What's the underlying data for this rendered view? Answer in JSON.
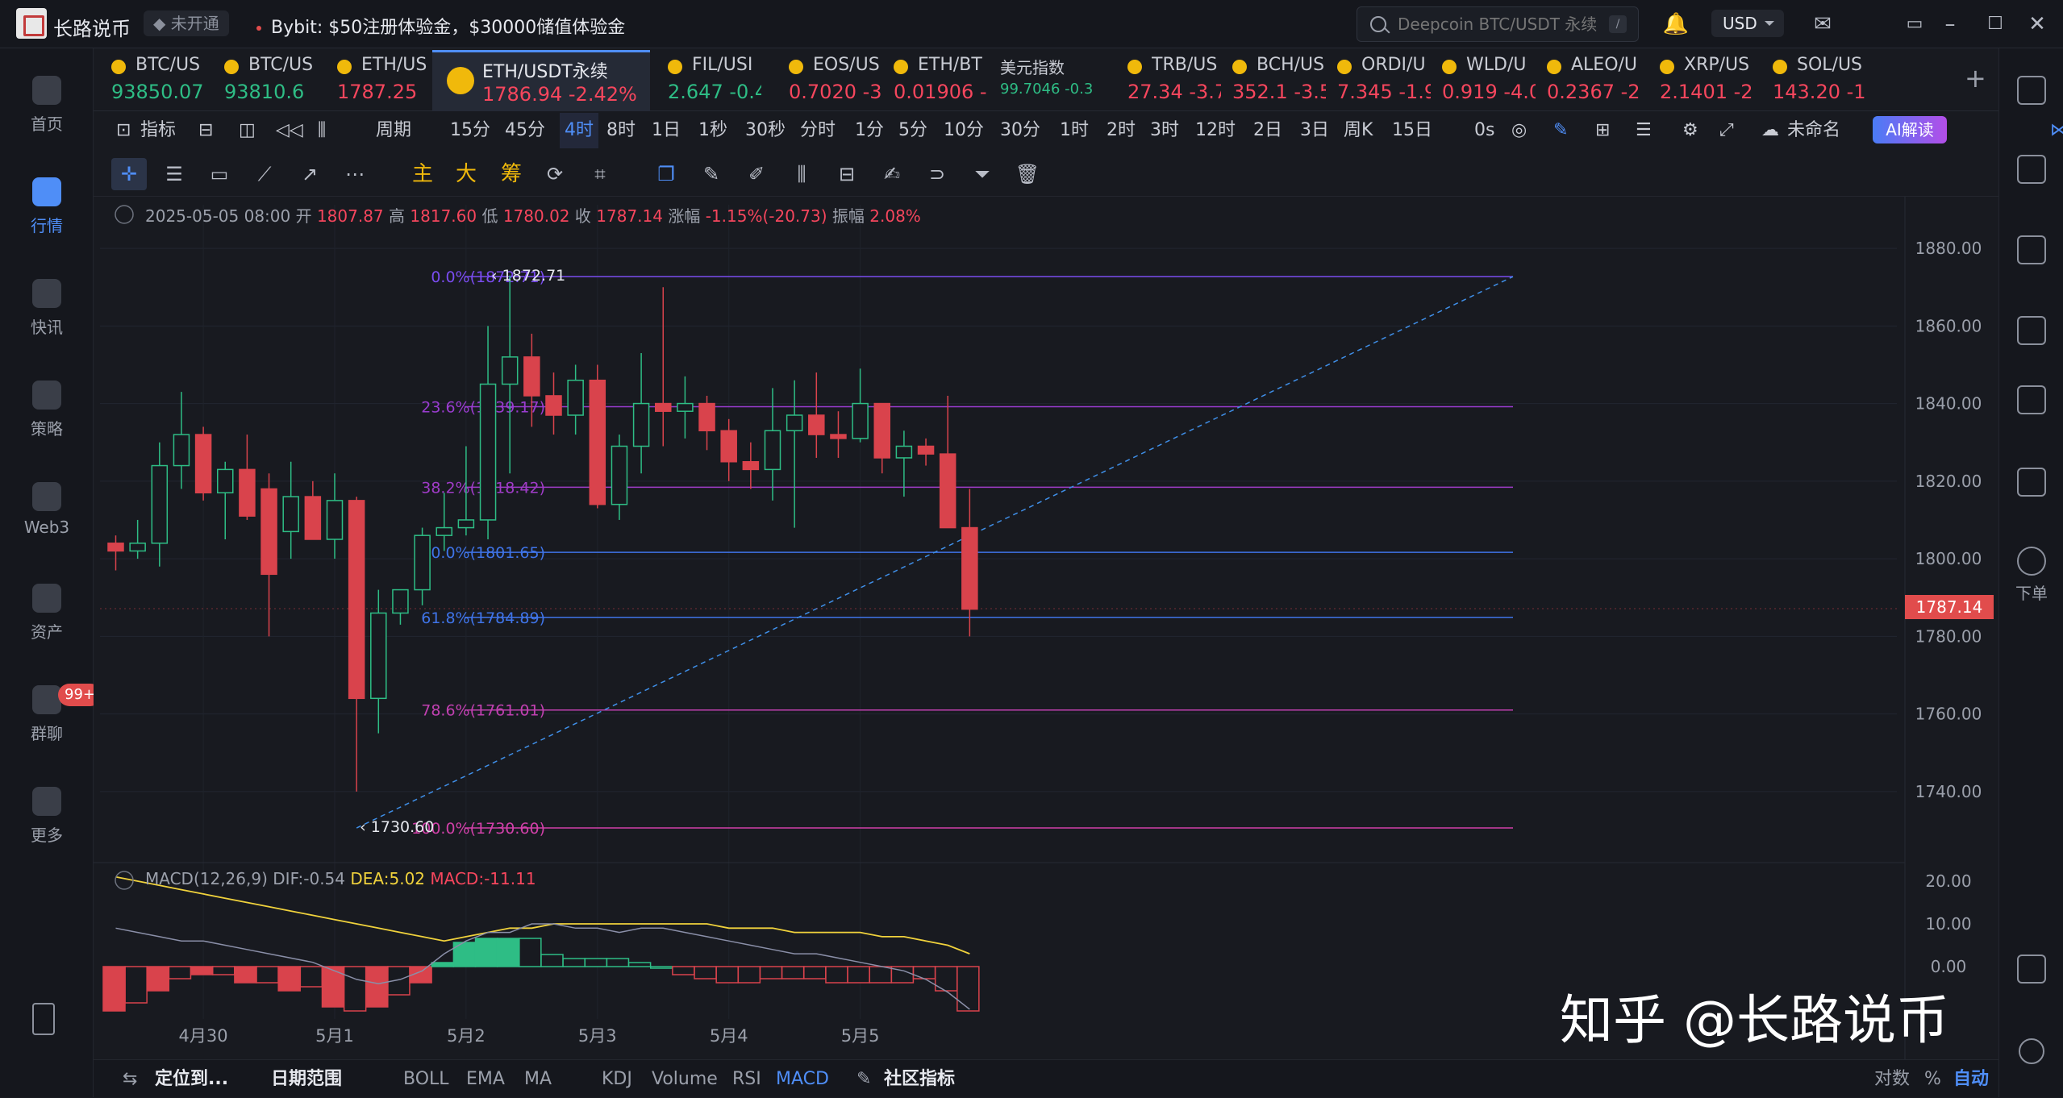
{
  "titlebar": {
    "app": "长路说币",
    "badge": "未开通",
    "promo": "Bybit: $50注册体验金，$30000储值体验金",
    "search_placeholder": "Deepcoin BTC/USDT 永续",
    "search_hint": "/",
    "currency": "USD"
  },
  "leftnav": [
    {
      "label": "首页"
    },
    {
      "label": "行情"
    },
    {
      "label": "快讯"
    },
    {
      "label": "策略"
    },
    {
      "label": "Web3"
    },
    {
      "label": "资产"
    },
    {
      "label": "群聊"
    },
    {
      "label": "更多"
    }
  ],
  "chat_badge": "99+",
  "rightnav": {
    "order": "下单"
  },
  "tickers": [
    {
      "name": "BTC/US",
      "price": "93850.07",
      "dir": "up"
    },
    {
      "name": "BTC/US",
      "price": "93810.6",
      "dir": "up"
    },
    {
      "name": "ETH/US",
      "price": "1787.25",
      "dir": "dn"
    },
    {
      "name": "ETH/USDT永续",
      "price": "1786.94",
      "change": "-2.42%",
      "dir": "dn"
    },
    {
      "name": "FIL/USI",
      "price": "2.647",
      "change": "-0.4",
      "dir": "up"
    },
    {
      "name": "EOS/US",
      "price": "0.7020",
      "change": "-3",
      "dir": "dn"
    },
    {
      "name": "ETH/BT",
      "price": "0.01906",
      "change": "-",
      "dir": "dn"
    },
    {
      "name": "美元指数",
      "price": "99.7046",
      "change": "-0.3",
      "dir": "up"
    },
    {
      "name": "TRB/US",
      "price": "27.34",
      "change": "-3.7",
      "dir": "dn"
    },
    {
      "name": "BCH/US",
      "price": "352.1",
      "change": "-3.5",
      "dir": "dn"
    },
    {
      "name": "ORDI/U",
      "price": "7.345",
      "change": "-1.9",
      "dir": "dn"
    },
    {
      "name": "WLD/U",
      "price": "0.919",
      "change": "-4.0",
      "dir": "dn"
    },
    {
      "name": "ALEO/U",
      "price": "0.2367",
      "change": "-2",
      "dir": "dn"
    },
    {
      "name": "XRP/US",
      "price": "2.1401",
      "change": "-2",
      "dir": "dn"
    },
    {
      "name": "SOL/US",
      "price": "143.20",
      "change": "-1",
      "dir": "dn"
    }
  ],
  "toolbar": {
    "indicator": "指标",
    "period": "周期",
    "timeframes": [
      "15分",
      "45分",
      "4时",
      "8时",
      "1日",
      "1秒",
      "30秒",
      "分时",
      "1分",
      "5分",
      "10分",
      "30分",
      "1时",
      "2时",
      "3时",
      "12时",
      "2日",
      "3日",
      "周K",
      "15日"
    ],
    "selected": "4时",
    "countdown": "0s",
    "layout_name": "未命名",
    "ai": "AI解读"
  },
  "drawtools": {
    "main": "主",
    "big": "大",
    "chip": "筹"
  },
  "ohlc": {
    "date": "2025-05-05 08:00",
    "open_label": "开",
    "open": "1807.87",
    "high_label": "高",
    "high": "1817.60",
    "low_label": "低",
    "low": "1780.02",
    "close_label": "收",
    "close": "1787.14",
    "chg_label": "涨幅",
    "chg": "-1.15%(-20.73)",
    "amp_label": "振幅",
    "amp": "2.08%"
  },
  "macd": {
    "name": "MACD(12,26,9)",
    "dif": "DIF:-0.54",
    "dea": "DEA:5.02",
    "macd": "MACD:-11.11"
  },
  "bottombar": {
    "locate": "定位到...",
    "range": "日期范围",
    "inds": [
      "BOLL",
      "EMA",
      "MA",
      "KDJ",
      "Volume",
      "RSI",
      "MACD"
    ],
    "community": "社区指标",
    "log": "对数",
    "pct": "%",
    "auto": "自动"
  },
  "watermark": "知乎 @长路说币",
  "chart_data": {
    "type": "candlestick",
    "symbol": "ETH/USDT永续",
    "interval": "4时",
    "ylim": [
      1725,
      1885
    ],
    "yticks": [
      "1880.00",
      "1860.00",
      "1840.00",
      "1820.00",
      "1800.00",
      "1780.00",
      "1760.00",
      "1740.00"
    ],
    "last_price": "1787.14",
    "xticks": [
      "4月30",
      "5月1",
      "5月2",
      "5月3",
      "5月4",
      "5月5"
    ],
    "fib": [
      {
        "label": "0.0%(1872.71)",
        "value": 1872.71,
        "color": "#7a4cf0"
      },
      {
        "label": "23.6%(1839.17)",
        "value": 1839.17,
        "color": "#9a3cd0"
      },
      {
        "label": "38.2%(1818.42)",
        "value": 1818.42,
        "color": "#a03cc8"
      },
      {
        "label": "50.0%(1801.65)",
        "value": 1801.65,
        "color": "#3f74e8"
      },
      {
        "label": "61.8%(1784.89)",
        "value": 1784.89,
        "color": "#3f74e8"
      },
      {
        "label": "78.6%(1761.01)",
        "value": 1761.01,
        "color": "#c040b0"
      },
      {
        "label": "100.0%(1730.60)",
        "value": 1730.6,
        "color": "#d040a8"
      }
    ],
    "marks": [
      {
        "label": "1872.71",
        "value": 1872.71
      },
      {
        "label": "1730.60",
        "value": 1730.6
      }
    ],
    "candles": [
      [
        1804,
        1806,
        1797,
        1802
      ],
      [
        1802,
        1810,
        1800,
        1804
      ],
      [
        1804,
        1830,
        1798,
        1824
      ],
      [
        1824,
        1843,
        1818,
        1832
      ],
      [
        1832,
        1834,
        1815,
        1817
      ],
      [
        1817,
        1825,
        1805,
        1823
      ],
      [
        1823,
        1832,
        1810,
        1811
      ],
      [
        1818,
        1822,
        1780,
        1796
      ],
      [
        1807,
        1825,
        1800,
        1816
      ],
      [
        1816,
        1820,
        1808,
        1805
      ],
      [
        1805,
        1822,
        1800,
        1815
      ],
      [
        1815,
        1816,
        1740,
        1764
      ],
      [
        1764,
        1792,
        1755,
        1786
      ],
      [
        1786,
        1791,
        1783,
        1792
      ],
      [
        1792,
        1808,
        1788,
        1806
      ],
      [
        1806,
        1817,
        1802,
        1808
      ],
      [
        1808,
        1829,
        1806,
        1810
      ],
      [
        1810,
        1860,
        1805,
        1845
      ],
      [
        1845,
        1873,
        1822,
        1852
      ],
      [
        1852,
        1858,
        1834,
        1842
      ],
      [
        1842,
        1848,
        1832,
        1837
      ],
      [
        1837,
        1850,
        1832,
        1846
      ],
      [
        1846,
        1850,
        1813,
        1814
      ],
      [
        1814,
        1832,
        1810,
        1829
      ],
      [
        1829,
        1853,
        1822,
        1840
      ],
      [
        1840,
        1870,
        1829,
        1838
      ],
      [
        1838,
        1847,
        1831,
        1840
      ],
      [
        1840,
        1842,
        1828,
        1833
      ],
      [
        1833,
        1836,
        1820,
        1825
      ],
      [
        1825,
        1830,
        1818,
        1823
      ],
      [
        1823,
        1844,
        1815,
        1833
      ],
      [
        1833,
        1846,
        1808,
        1837
      ],
      [
        1837,
        1848,
        1826,
        1832
      ],
      [
        1832,
        1838,
        1826,
        1831
      ],
      [
        1831,
        1849,
        1830,
        1840
      ],
      [
        1840,
        1840,
        1822,
        1826
      ],
      [
        1826,
        1833,
        1816,
        1829
      ],
      [
        1829,
        1831,
        1824,
        1827
      ],
      [
        1827,
        1842,
        1816,
        1808
      ],
      [
        1808,
        1818,
        1780,
        1787
      ]
    ],
    "macd_hist": [
      -11,
      -9,
      -6,
      -3,
      -2,
      -2,
      -4,
      -4,
      -6,
      -5,
      -10,
      -11,
      -10,
      -7,
      -4,
      1,
      6,
      7,
      7,
      7,
      3,
      2,
      2,
      2,
      1,
      0,
      -2,
      -3,
      -4,
      -4,
      -3,
      -3,
      -3,
      -4,
      -4,
      -4,
      -4,
      -3,
      -6,
      -11
    ]
  }
}
